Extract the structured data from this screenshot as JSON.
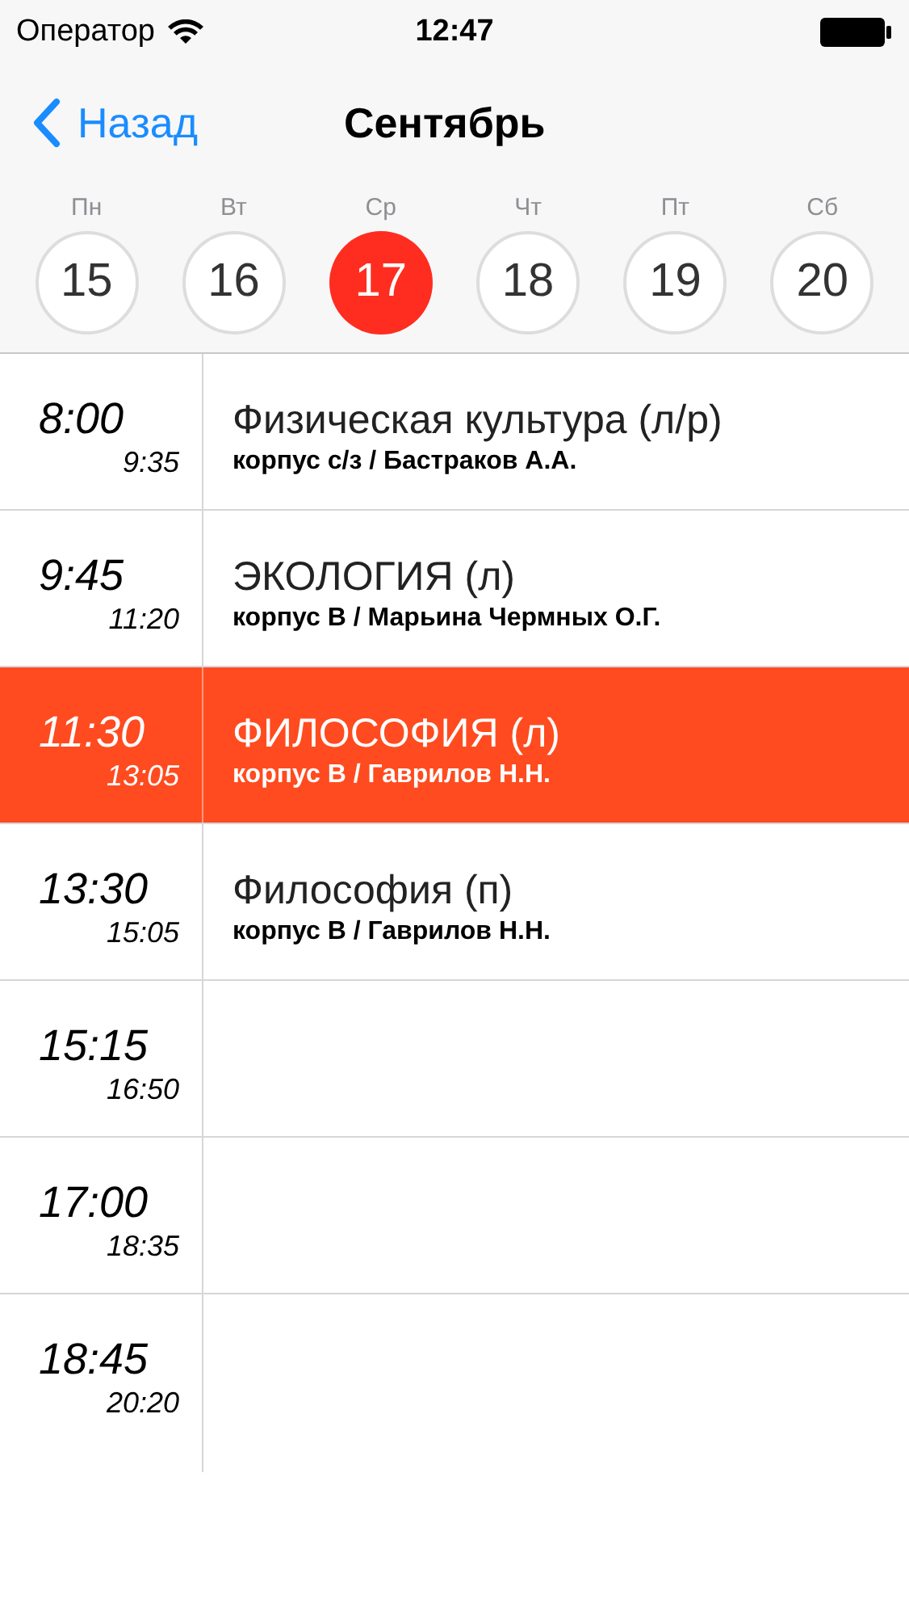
{
  "status_bar": {
    "carrier": "Оператор",
    "time": "12:47"
  },
  "nav": {
    "back": "Назад",
    "title": "Сентябрь"
  },
  "days": [
    {
      "weekday": "Пн",
      "day": "15",
      "selected": false
    },
    {
      "weekday": "Вт",
      "day": "16",
      "selected": false
    },
    {
      "weekday": "Ср",
      "day": "17",
      "selected": true
    },
    {
      "weekday": "Чт",
      "day": "18",
      "selected": false
    },
    {
      "weekday": "Пт",
      "day": "19",
      "selected": false
    },
    {
      "weekday": "Сб",
      "day": "20",
      "selected": false
    }
  ],
  "lessons": [
    {
      "start": "8:00",
      "end": "9:35",
      "title": "Физическая культура (л/р)",
      "place": "корпус с/з / Бастраков А.А.",
      "selected": false
    },
    {
      "start": "9:45",
      "end": "11:20",
      "title": "ЭКОЛОГИЯ (л)",
      "place": "корпус В / Марьина Чермных О.Г.",
      "selected": false
    },
    {
      "start": "11:30",
      "end": "13:05",
      "title": "ФИЛОСОФИЯ (л)",
      "place": "корпус В / Гаврилов Н.Н.",
      "selected": true
    },
    {
      "start": "13:30",
      "end": "15:05",
      "title": "Философия (п)",
      "place": "корпус В / Гаврилов Н.Н.",
      "selected": false
    },
    {
      "start": "15:15",
      "end": "16:50",
      "selected": false
    },
    {
      "start": "17:00",
      "end": "18:35",
      "selected": false
    },
    {
      "start": "18:45",
      "end": "20:20",
      "selected": false
    }
  ]
}
